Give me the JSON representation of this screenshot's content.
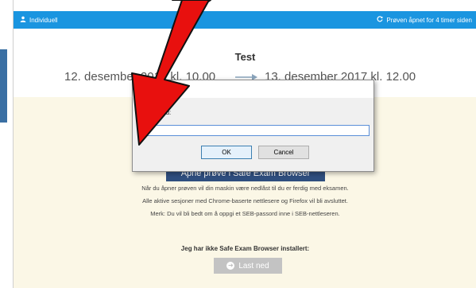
{
  "topbar": {
    "user_label": "Individuell",
    "status_text": "Prøven åpnet for 4 timer siden",
    "color": "#1a95e0"
  },
  "exam": {
    "title": "Test",
    "start": "12. desember 2017 kl. 10.00",
    "end": "13. desember 2017 kl. 12.00"
  },
  "panel": {
    "open_button_label": "Åpne prøve i Safe Exam Browser",
    "info_lines": [
      "Når du åpner prøven vil din maskin være nedlåst til du er ferdig med eksamen.",
      "Alle aktive sesjoner med Chrome-baserte nettlesere og Firefox vil bli avsluttet.",
      "Merk: Du vil bli bedt om å oppgi et SEB-passord inne i SEB-nettleseren."
    ],
    "no_seb_heading": "Jeg har ikke Safe Exam Browser installert:",
    "download_label": "Last ned",
    "background": "#fbf7e6"
  },
  "dialog": {
    "title": "Lo         gs",
    "prompt": "Ente        word:",
    "password_value": "",
    "ok_label": "OK",
    "cancel_label": "Cancel"
  },
  "annotation": {
    "arrow_color": "#e8100e"
  },
  "icons": [
    "user-icon",
    "refresh-icon",
    "arrow-right-icon",
    "download-icon"
  ]
}
